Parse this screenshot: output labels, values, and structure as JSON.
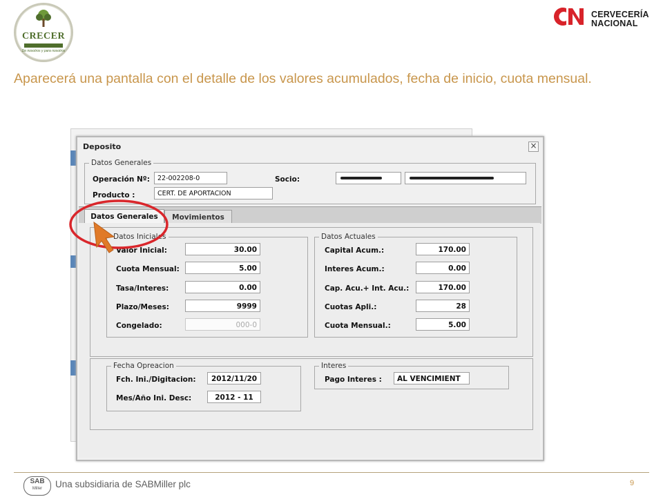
{
  "slide": {
    "logo_left": {
      "name": "CRECER",
      "tagline": "De nosotros y para nosotros"
    },
    "logo_right": {
      "line1": "CERVECERÍA",
      "line2": "NACIONAL"
    },
    "instruction": "Aparecerá una pantalla con el detalle de los valores acumulados, fecha de inicio, cuota mensual.",
    "footer": "Una subsidiaria de SABMiller plc",
    "footer_logo": {
      "line1": "SAB",
      "line2": "Miller"
    },
    "page_number": "9"
  },
  "dialog": {
    "title": "Deposito",
    "close_glyph": "×",
    "header_group": {
      "legend": "Datos Generales",
      "operacion_label": "Operación Nº:",
      "operacion_value": "22-002208-0",
      "producto_label": "Producto :",
      "producto_value": "CERT. DE APORTACION",
      "socio_label": "Socio:"
    },
    "tabs": [
      {
        "label": "Datos Generales",
        "active": true
      },
      {
        "label": "Movimientos",
        "active": false
      }
    ],
    "datos_iniciales": {
      "legend": "Datos Iniciales",
      "rows": [
        {
          "label": "Valor Inicial:",
          "value": "30.00"
        },
        {
          "label": "Cuota Mensual:",
          "value": "5.00"
        },
        {
          "label": "Tasa/Interes:",
          "value": "0.00"
        },
        {
          "label": "Plazo/Meses:",
          "value": "9999"
        },
        {
          "label": "Congelado:",
          "value": "000-0"
        }
      ]
    },
    "datos_actuales": {
      "legend": "Datos Actuales",
      "rows": [
        {
          "label": "Capital Acum.:",
          "value": "170.00"
        },
        {
          "label": "Interes Acum.:",
          "value": "0.00"
        },
        {
          "label": "Cap. Acu.+ Int. Acu.:",
          "value": "170.00"
        },
        {
          "label": "Cuotas Apli.:",
          "value": "28"
        },
        {
          "label": "Cuota Mensual.:",
          "value": "5.00"
        }
      ]
    },
    "fecha_operacion": {
      "legend": "Fecha Opreacion",
      "rows": [
        {
          "label": "Fch. Ini./Digitacion:",
          "value": "2012/11/20"
        },
        {
          "label": "Mes/Año Ini. Desc:",
          "value": "2012 - 11"
        }
      ]
    },
    "interes": {
      "legend": "Interes",
      "label": "Pago Interes :",
      "value": "AL VENCIMIENT"
    }
  },
  "colors": {
    "instruction_text": "#c8964c",
    "annotation_red": "#d9262b",
    "annotation_arrow": "#e07a28",
    "crecer_green": "#4f6e2c",
    "cn_red": "#d8232a"
  }
}
